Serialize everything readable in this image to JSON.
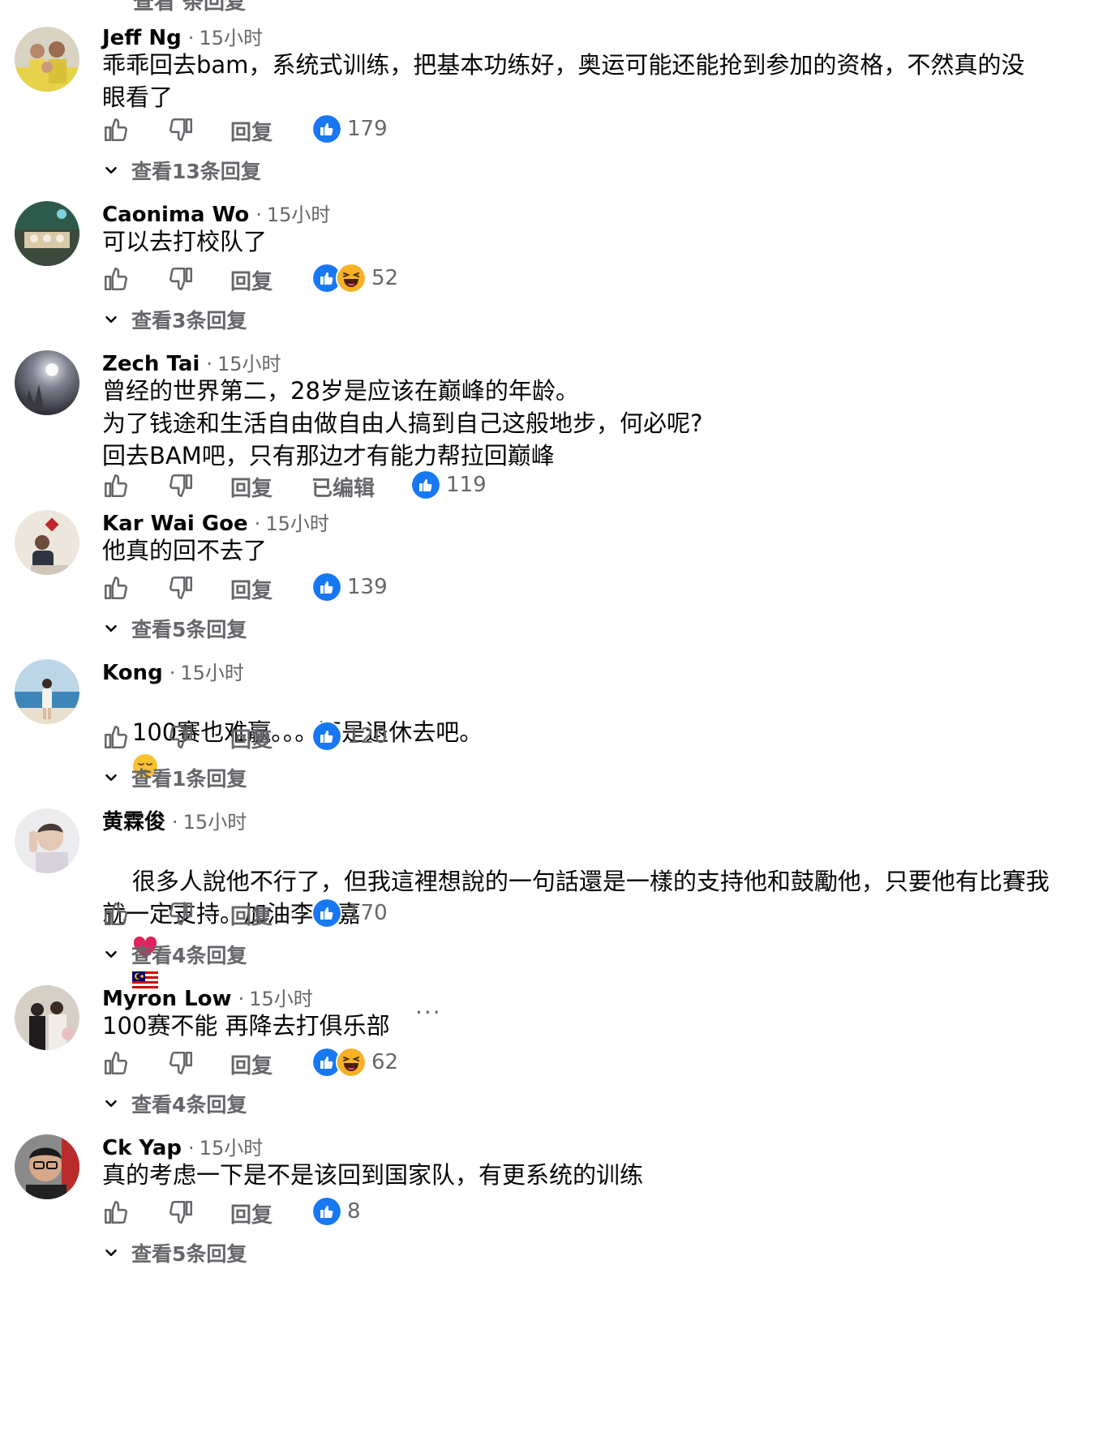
{
  "partial_top_text": "查看 条回复",
  "action_labels": {
    "reply": "回复",
    "edited": "已编辑"
  },
  "icons": {
    "like": "thumbs-up-outline-icon",
    "dislike": "thumbs-down-outline-icon",
    "reaction_like": "like-reaction-icon",
    "reaction_haha": "haha-reaction-icon",
    "chevron": "chevron-down-icon",
    "more": "more-options-icon"
  },
  "colors": {
    "like_blue": "#1877f2",
    "haha_yellow": "#f7b125",
    "heart_red": "#e0245e",
    "secondary_text": "#65676b"
  },
  "comments": [
    {
      "author": "Jeff Ng",
      "time": "15小时",
      "text": "乖乖回去bam，系统式训练，把基本功练好，奥运可能还能抢到参加的资格，不然真的没\n眼看了",
      "reactions": [
        "like"
      ],
      "reaction_count": "179",
      "view_replies": "查看13条回复"
    },
    {
      "author": "Caonima Wo",
      "time": "15小时",
      "text": "可以去打校队了",
      "reactions": [
        "like",
        "haha"
      ],
      "reaction_count": "52",
      "view_replies": "查看3条回复"
    },
    {
      "author": "Zech Tai",
      "time": "15小时",
      "text": "曾经的世界第二，28岁是应该在巅峰的年龄。\n为了钱途和生活自由做自由人搞到自己这般地步，何必呢?\n回去BAM吧，只有那边才有能力帮拉回巅峰",
      "edited": true,
      "reactions": [
        "like"
      ],
      "reaction_count": "119"
    },
    {
      "author": "Kar Wai Goe",
      "time": "15小时",
      "text": "他真的回不去了",
      "reactions": [
        "like"
      ],
      "reaction_count": "139",
      "view_replies": "查看5条回复"
    },
    {
      "author": "Kong",
      "time": "15小时",
      "text": "100赛也难赢。。。还是退休去吧。",
      "trailing_emoji": "pensive-face-emoji",
      "reactions": [
        "like"
      ],
      "reaction_count": "120",
      "view_replies": "查看1条回复"
    },
    {
      "author": "黄霖俊",
      "time": "15小时",
      "text": "很多人說他不行了，但我這裡想說的一句話還是一樣的支持他和鼓勵他，只要他有比賽我\n就一定支持。加油李梓嘉",
      "trailing_emoji": "heart-and-malaysia-flag-emoji",
      "reactions": [
        "like"
      ],
      "reaction_count": "170",
      "view_replies": "查看4条回复"
    },
    {
      "author": "Myron Low",
      "time": "15小时",
      "text": "100赛不能 再降去打俱乐部",
      "has_more_menu": true,
      "more_label": "···",
      "reactions": [
        "like",
        "haha"
      ],
      "reaction_count": "62",
      "view_replies": "查看4条回复"
    },
    {
      "author": "Ck Yap",
      "time": "15小时",
      "text": "真的考虑一下是不是该回到国家队，有更系统的训练",
      "reactions": [
        "like"
      ],
      "reaction_count": "8",
      "view_replies": "查看5条回复"
    }
  ]
}
